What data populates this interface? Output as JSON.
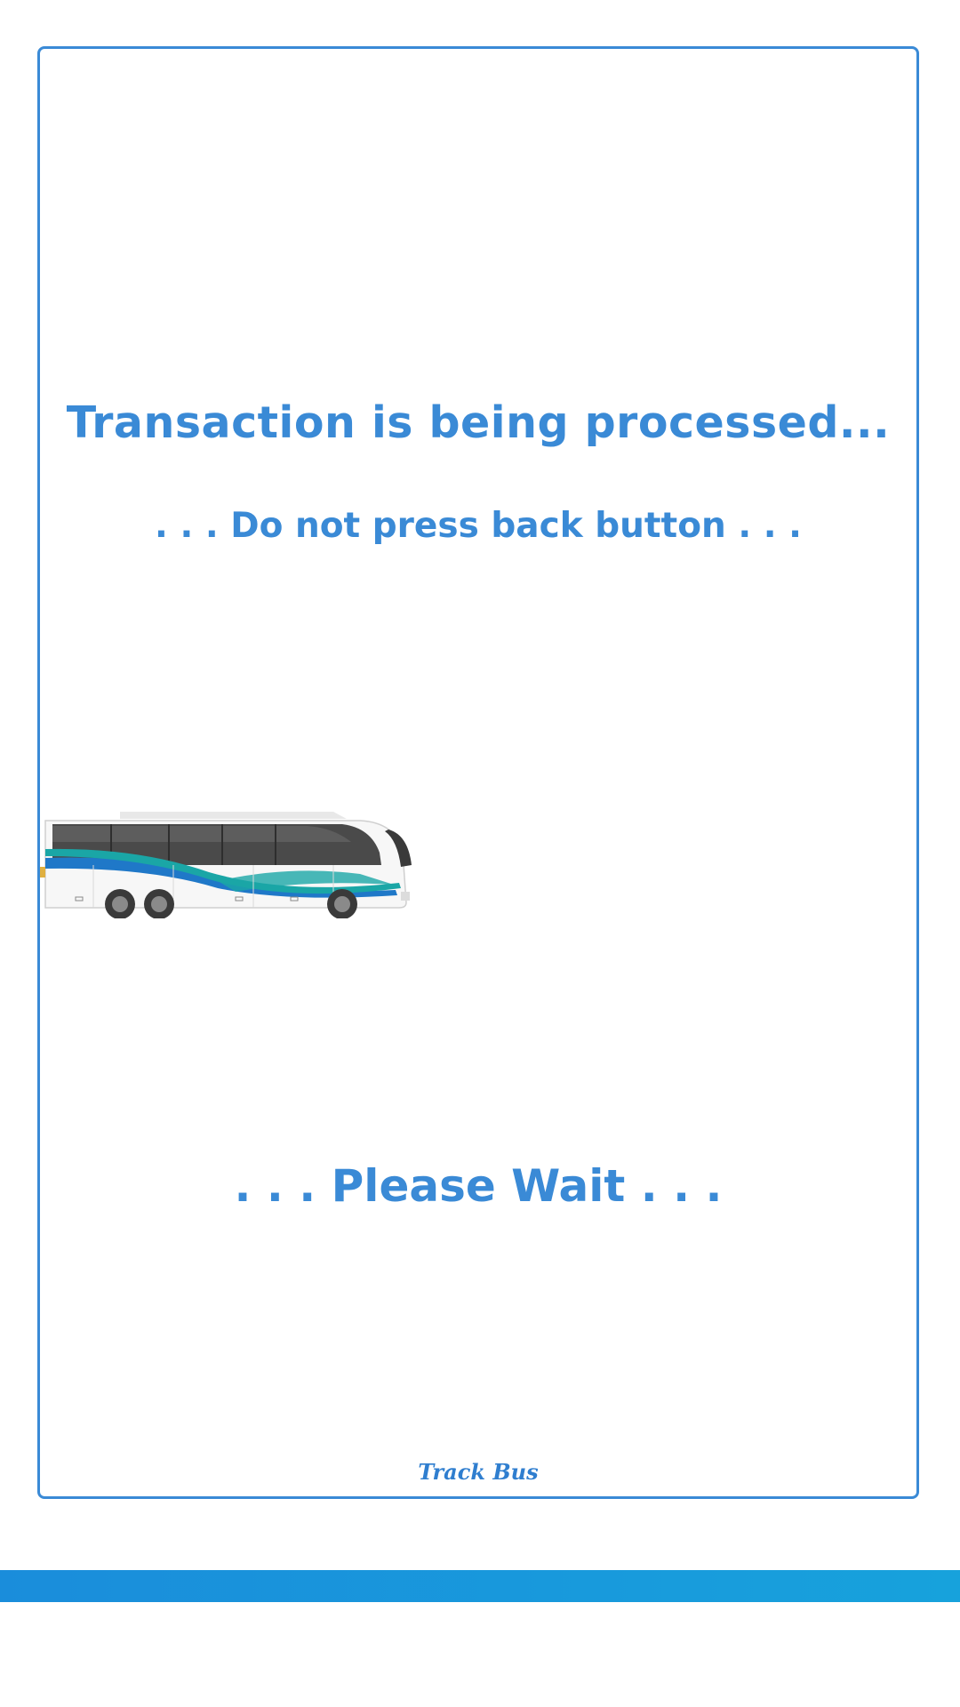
{
  "message": {
    "title": "Transaction is being processed...",
    "subtitle": ". . . Do not press back button . . .",
    "wait": ". . . Please Wait . . ."
  },
  "brand": {
    "name": "Track Bus"
  },
  "colors": {
    "accent": "#3a8ad6",
    "bar": "#1a8ddb",
    "bus_stripe_blue": "#1f78c8",
    "bus_stripe_teal": "#1aa6a6"
  },
  "icons": {
    "animation": "bus-icon"
  }
}
